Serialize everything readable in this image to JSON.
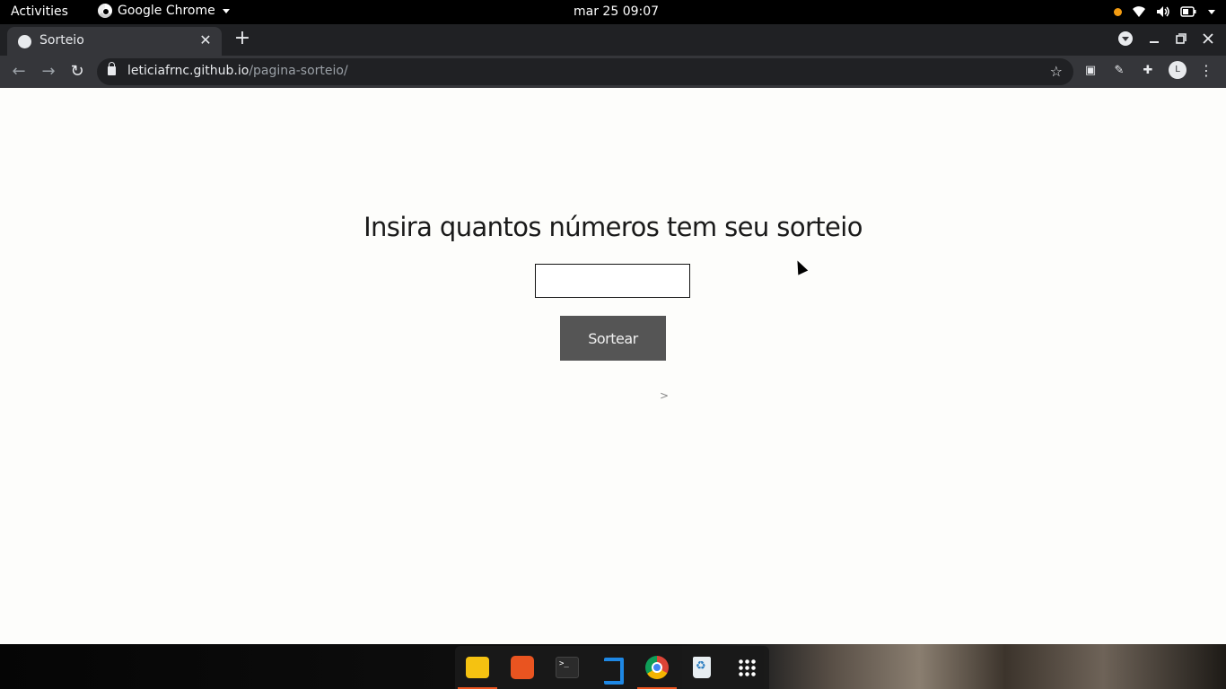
{
  "system_bar": {
    "activities": "Activities",
    "app_name": "Google Chrome",
    "clock": "mar 25  09:07"
  },
  "browser": {
    "tab_title": "Sorteio",
    "close_glyph": "✕",
    "new_tab_glyph": "+",
    "url_host": "leticiafrnc.github.io",
    "url_path": "/pagina-sorteio/",
    "profile_initial": "L"
  },
  "page": {
    "heading": "Insira quantos números tem seu sorteio",
    "input_value": "",
    "button_label": "Sortear",
    "result_text": ">"
  },
  "colors": {
    "button_bg": "#555555",
    "page_bg": "#fdfdfb",
    "ubuntu_accent": "#e95420"
  }
}
